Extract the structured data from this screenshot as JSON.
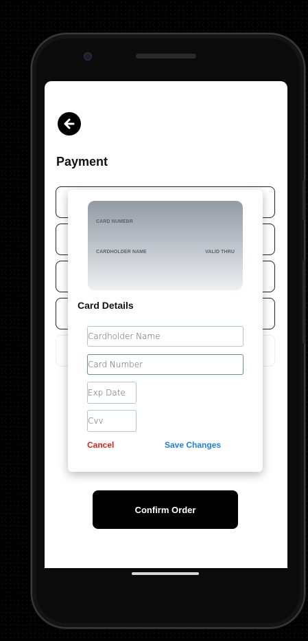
{
  "page": {
    "title": "Payment"
  },
  "modal": {
    "card_preview": {
      "card_number_label": "CARD NUMEBR",
      "cardholder_label": "CARDHOLDER NAME",
      "valid_thru_label": "VALID THRU"
    },
    "title": "Card Details",
    "fields": {
      "cardholder_placeholder": "Cardholder Name",
      "card_number_placeholder": "Card Number",
      "exp_date_placeholder": "Exp Date",
      "cvv_placeholder": "Cvv"
    },
    "cancel_label": "Cancel",
    "save_label": "Save Changes"
  },
  "footer": {
    "confirm_label": "Confirm Order"
  },
  "icons": {
    "back": "arrow-left-circle-icon"
  },
  "colors": {
    "cancel": "#e32020",
    "save": "#1c7fe8",
    "primary": "#000000"
  }
}
